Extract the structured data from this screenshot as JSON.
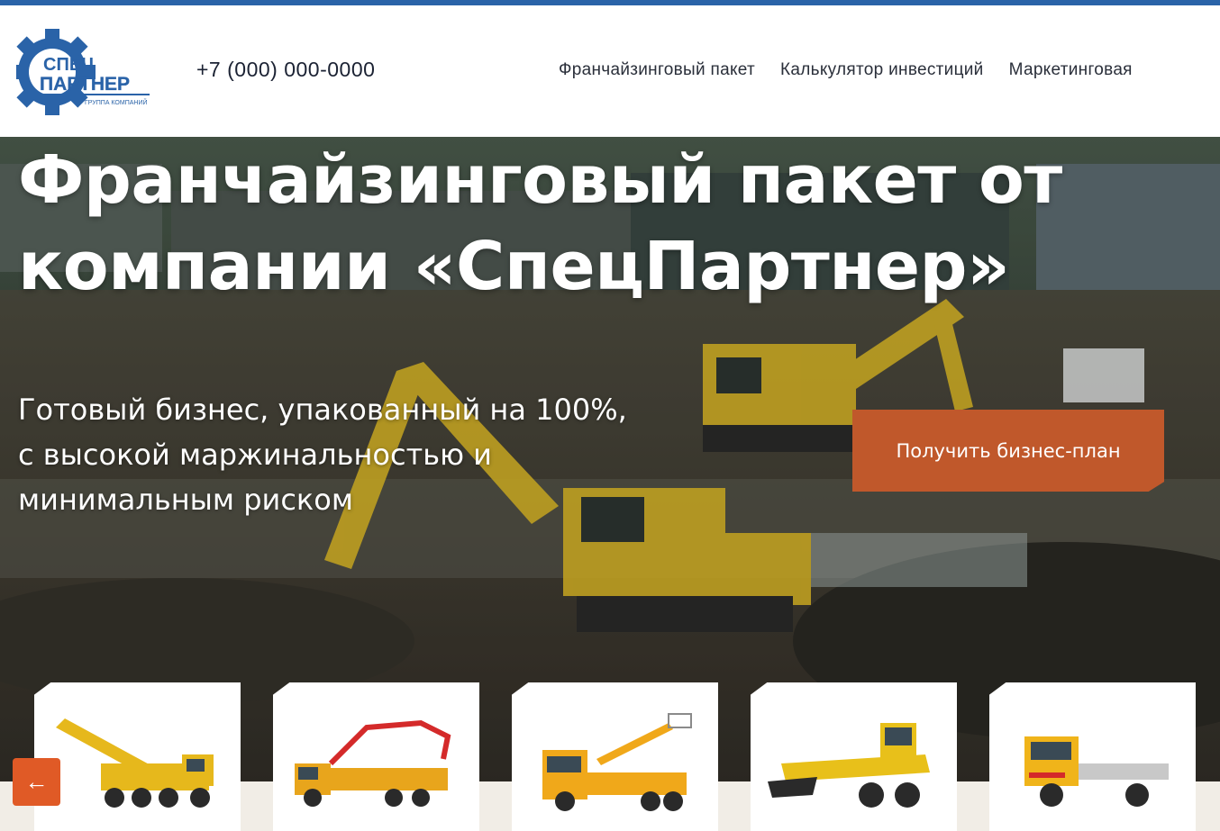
{
  "header": {
    "logo": {
      "line1": "СПЕЦ",
      "line2": "ПАРТНЕР",
      "tagline": "ГРУППА КОМПАНИЙ",
      "icon": "gear-logo-icon"
    },
    "phone": "+7 (000) 000-0000",
    "nav": [
      {
        "label": "Франчайзинговый пакет"
      },
      {
        "label": "Калькулятор инвестиций"
      },
      {
        "label": "Маркетинговая"
      }
    ]
  },
  "hero": {
    "title": "Франчайзинговый пакет от компании «СпецПартнер»",
    "subtitle": "Готовый бизнес, упакованный на 100%, с высокой маржинальностью и минимальным риском",
    "cta_label": "Получить бизнес-план",
    "background": "construction-site-excavators-photo"
  },
  "slider": {
    "prev_label": "←",
    "cards": [
      {
        "name": "truck-crane"
      },
      {
        "name": "concrete-pump-truck"
      },
      {
        "name": "aerial-platform-truck"
      },
      {
        "name": "motor-grader"
      },
      {
        "name": "tow-truck"
      }
    ]
  },
  "colors": {
    "accent_bar": "#2a63a8",
    "cta": "#c0582b",
    "arrow": "#e05a26",
    "logo_blue": "#2a63a8"
  }
}
